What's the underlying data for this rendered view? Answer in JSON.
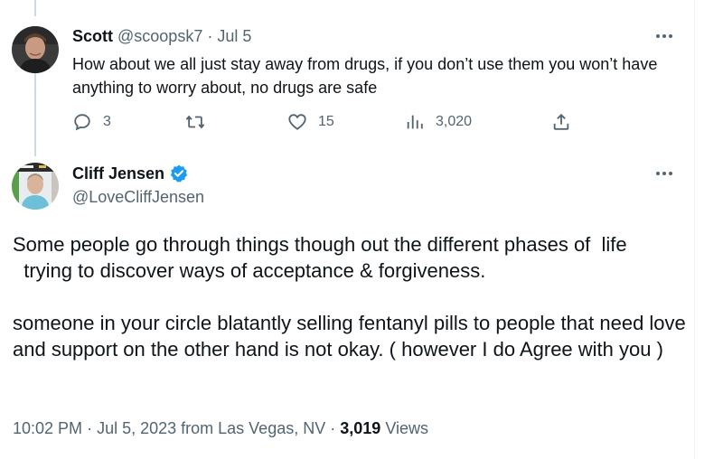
{
  "reply_tweet": {
    "name": "Scott",
    "handle": "@scoopsk7",
    "separator": "·",
    "date": "Jul 5",
    "text": "How about we all just stay away from drugs, if you don’t use them you won’t have anything to worry about, no drugs are safe",
    "actions": {
      "replies": "3",
      "retweets": "",
      "likes": "15",
      "views": "3,020"
    }
  },
  "main_tweet": {
    "name": "Cliff Jensen",
    "verified": true,
    "handle": "@LoveCliffJensen",
    "paragraph_1": "Some people go through things though out the different phases of  life\n  trying to discover ways of acceptance & forgiveness.",
    "paragraph_2": "someone in your circle blatantly selling fentanyl pills to people that need love and support on the other hand is not okay. ( however I do Agree with you )",
    "time": "10:02 PM",
    "separator": "·",
    "date_location": "Jul 5, 2023 from Las Vegas, NV",
    "views_count": "3,019",
    "views_label": "Views"
  },
  "colors": {
    "text": "#0f1419",
    "muted": "#536471",
    "verified_blue": "#1d9bf0",
    "thread_line": "#cfd9de"
  },
  "icons": {
    "reply": "reply-icon",
    "retweet": "retweet-icon",
    "like": "heart-icon",
    "views": "views-chart-icon",
    "share": "share-icon",
    "more": "more-icon",
    "verified": "verified-badge-icon"
  }
}
